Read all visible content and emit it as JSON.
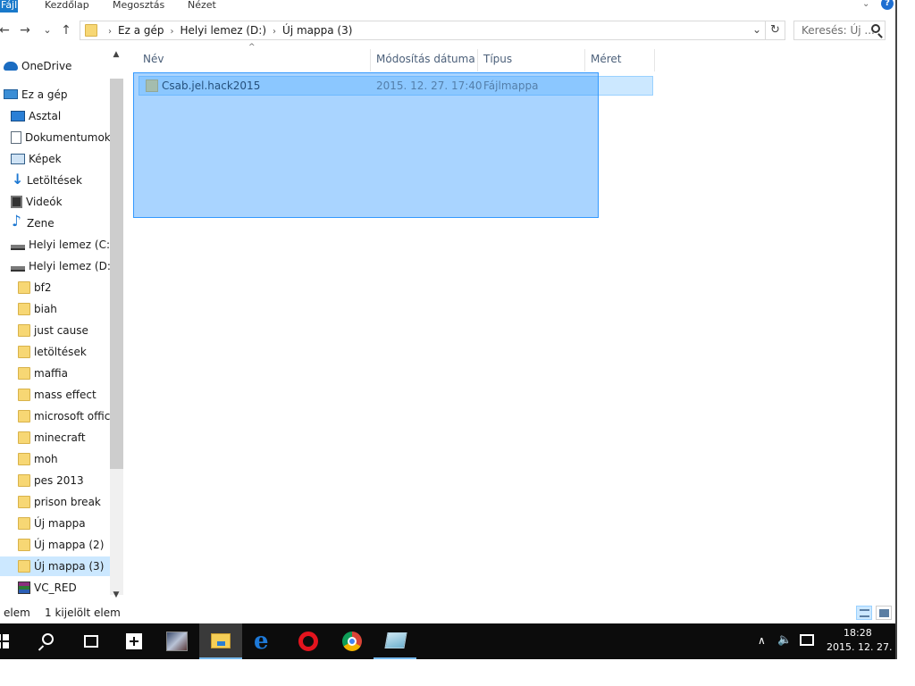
{
  "ribbon": {
    "tabs": [
      "Fájl",
      "Kezdőlap",
      "Megosztás",
      "Nézet"
    ],
    "help_label": "?"
  },
  "nav_buttons": {
    "back": "←",
    "forward": "→",
    "recent": "⌄",
    "up": "↑"
  },
  "address": {
    "crumbs": [
      "Ez a gép",
      "Helyi lemez (D:)",
      "Új mappa (3)"
    ],
    "dropdown": "⌄",
    "refresh": "↻"
  },
  "search": {
    "placeholder": "Keresés: Új ..."
  },
  "navpane": {
    "items": [
      {
        "label": "OneDrive",
        "icon": "onedrive-icon"
      },
      {
        "label": "Ez a gép",
        "icon": "computer-icon"
      },
      {
        "label": "Asztal",
        "icon": "desktop-icon"
      },
      {
        "label": "Dokumentumok",
        "icon": "documents-icon"
      },
      {
        "label": "Képek",
        "icon": "pictures-icon"
      },
      {
        "label": "Letöltések",
        "icon": "downloads-icon"
      },
      {
        "label": "Videók",
        "icon": "videos-icon"
      },
      {
        "label": "Zene",
        "icon": "music-icon"
      },
      {
        "label": "Helyi lemez (C:)",
        "icon": "drive-icon"
      },
      {
        "label": "Helyi lemez (D:)",
        "icon": "drive-icon"
      },
      {
        "label": "bf2",
        "icon": "folder-icon"
      },
      {
        "label": "biah",
        "icon": "folder-icon"
      },
      {
        "label": "just cause",
        "icon": "folder-icon"
      },
      {
        "label": "letöltések",
        "icon": "folder-icon"
      },
      {
        "label": "maffia",
        "icon": "folder-icon"
      },
      {
        "label": "mass effect",
        "icon": "folder-icon"
      },
      {
        "label": "microsoft office",
        "icon": "folder-icon"
      },
      {
        "label": "minecraft",
        "icon": "folder-icon"
      },
      {
        "label": "moh",
        "icon": "folder-icon"
      },
      {
        "label": "pes 2013",
        "icon": "folder-icon"
      },
      {
        "label": "prison break",
        "icon": "folder-icon"
      },
      {
        "label": "Új mappa",
        "icon": "folder-icon"
      },
      {
        "label": "Új mappa (2)",
        "icon": "folder-icon"
      },
      {
        "label": "Új mappa (3)",
        "icon": "folder-icon",
        "selected": true
      },
      {
        "label": "VC_RED",
        "icon": "winrar-icon"
      }
    ]
  },
  "columns": {
    "name": "Név",
    "date": "Módosítás dátuma",
    "type": "Típus",
    "size": "Méret"
  },
  "files": [
    {
      "name": "Csab.jel.hack2015",
      "date": "2015. 12. 27. 17:40",
      "type": "Fájlmappa",
      "size": ""
    }
  ],
  "status": {
    "count": "elem",
    "selected": "1 kijelölt elem"
  },
  "clock": {
    "time": "18:28",
    "date": "2015. 12. 27."
  }
}
